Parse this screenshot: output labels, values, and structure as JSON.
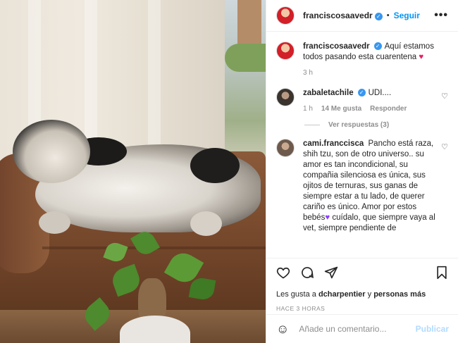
{
  "header": {
    "username": "franciscosaavedr",
    "separator": "•",
    "follow_label": "Seguir",
    "more_icon": "more-horizontal-icon"
  },
  "caption": {
    "username": "franciscosaavedr",
    "text": "Aquí estamos todos pasando esta cuarentena",
    "heart": "♥",
    "time": "3 h"
  },
  "comments": [
    {
      "username": "zabaletachile",
      "text": "UDI....",
      "time": "1 h",
      "likes": "14 Me gusta",
      "reply_label": "Responder",
      "view_replies": "Ver respuestas (3)"
    },
    {
      "username": "cami.franccisca",
      "text_part1": "Pancho está raza, shih tzu, son de otro universo.. su amor es tan incondicional, su compañia silenciosa es única, sus ojitos de ternuras, sus ganas de siempre estar a tu lado, de querer cariño es único. Amor por estos bebés",
      "heart": "♥",
      "text_part2": " cuídalo, que siempre vaya al vet, siempre pendiente de"
    }
  ],
  "actions": {
    "likes_prefix": "Les gusta a ",
    "likes_user": "dcharpentier",
    "likes_mid": " y ",
    "likes_others": "personas más",
    "timestamp": "HACE 3 HORAS"
  },
  "add_comment": {
    "placeholder": "Añade un comentario...",
    "post_label": "Publicar"
  },
  "colors": {
    "accent": "#0095f6",
    "verified": "#3897f0",
    "muted": "#8e8e8e",
    "post_disabled": "#b3dbff"
  }
}
